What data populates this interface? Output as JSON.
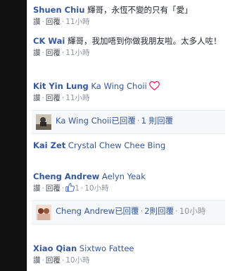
{
  "comments": [
    {
      "name": "Shuen Chiu",
      "text": "輝哥，永恆不變的只有「愛」",
      "actions": {
        "like": "讚",
        "reply": "回覆",
        "time": "11小時"
      }
    },
    {
      "name": "CK Wai",
      "text": "輝哥，我加唔到你做我朋友啦。太多人咗！",
      "actions": {
        "like": "讚",
        "reply": "回覆",
        "time": "11小時"
      }
    },
    {
      "name": "Kit Yin Lung",
      "text": "Ka Wing Choii",
      "actions": {
        "like": "讚",
        "reply": "回覆",
        "time": "11小時"
      },
      "reply_summary": {
        "author": "Ka Wing Choii",
        "verb": "已回覆",
        "count": "1 則回覆"
      }
    },
    {
      "name": "Kai Zet",
      "text": "Crystal Chew Chee Bing"
    },
    {
      "name": "Cheng Andrew",
      "text": "Aelyn Yeak",
      "actions": {
        "like": "讚",
        "reply": "回覆",
        "likes": "1",
        "time": "10小時"
      },
      "reply_summary": {
        "author": "Cheng Andrew",
        "verb": "已回覆",
        "count": "2則回覆",
        "time": "10小時"
      }
    },
    {
      "name": "Xiao Qian",
      "text": "Sixtwo Fattee",
      "actions": {
        "like": "讚",
        "reply": "回覆",
        "time": "10小時"
      }
    }
  ],
  "colors": {
    "name": "#365899",
    "meta": "#90949c",
    "heart": "#e0245e",
    "like": "#4267b2"
  },
  "icons": {
    "heart": "heart-icon",
    "like": "thumbs-up-icon"
  }
}
